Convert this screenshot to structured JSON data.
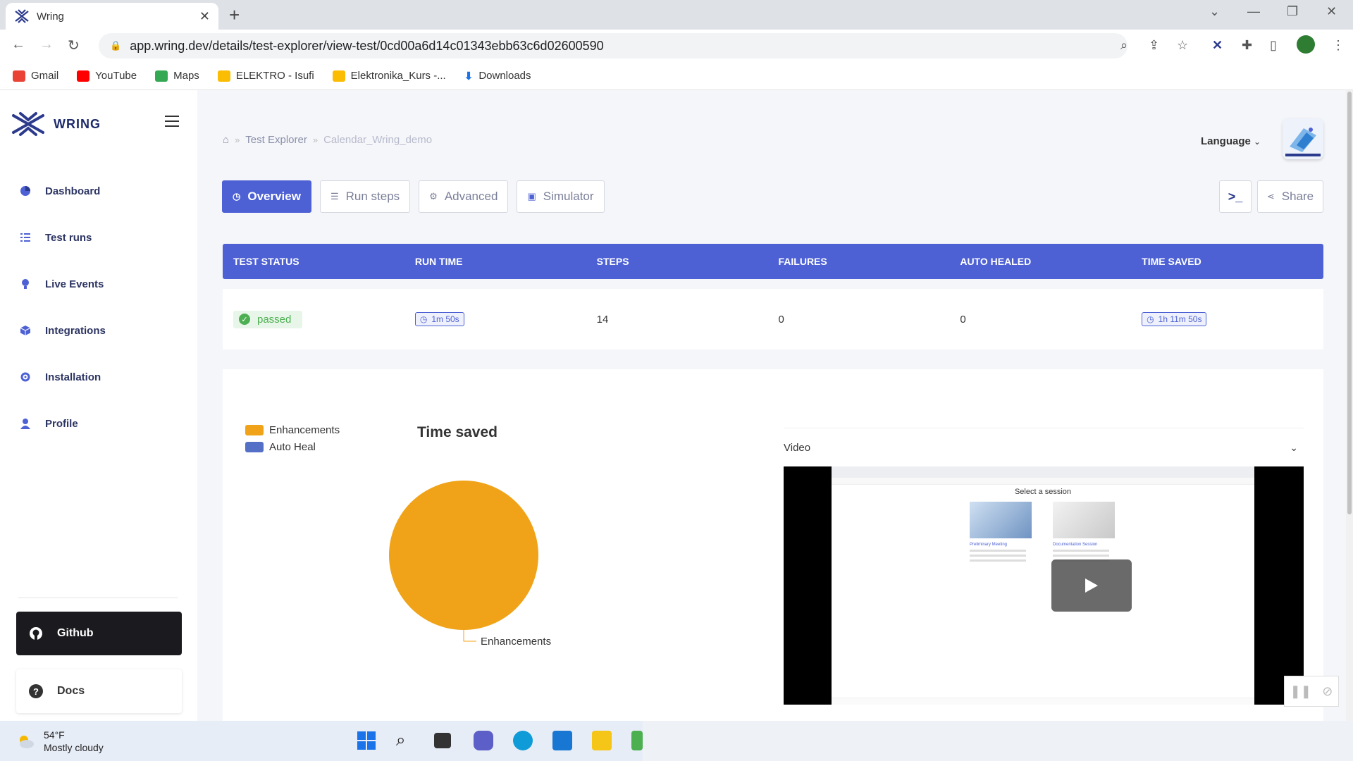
{
  "browser": {
    "tab_title": "Wring",
    "url": "app.wring.dev/details/test-explorer/view-test/0cd00a6d14c01343ebb63c6d02600590",
    "bookmarks": [
      {
        "label": "Gmail",
        "color": "#ea4335"
      },
      {
        "label": "YouTube",
        "color": "#ff0000"
      },
      {
        "label": "Maps",
        "color": "#34a853"
      },
      {
        "label": "ELEKTRO - Isufi",
        "color": "#fbbc04"
      },
      {
        "label": "Elektronika_Kurs -...",
        "color": "#fbbc04"
      },
      {
        "label": "Downloads",
        "color": "#1a73e8"
      }
    ]
  },
  "sidebar": {
    "logo_text": "WRING",
    "items": [
      {
        "label": "Dashboard",
        "icon": "pie-chart-icon"
      },
      {
        "label": "Test runs",
        "icon": "list-icon"
      },
      {
        "label": "Live Events",
        "icon": "bulb-icon"
      },
      {
        "label": "Integrations",
        "icon": "cube-icon"
      },
      {
        "label": "Installation",
        "icon": "gear-icon"
      },
      {
        "label": "Profile",
        "icon": "user-icon"
      }
    ],
    "github_label": "Github",
    "docs_label": "Docs"
  },
  "header": {
    "breadcrumb": [
      "Test Explorer",
      "Calendar_Wring_demo"
    ],
    "language_label": "Language"
  },
  "tabs": {
    "overview": "Overview",
    "run_steps": "Run steps",
    "advanced": "Advanced",
    "simulator": "Simulator",
    "share": "Share",
    "terminal": ">_"
  },
  "stats": {
    "headers": [
      "TEST STATUS",
      "RUN TIME",
      "STEPS",
      "FAILURES",
      "AUTO HEALED",
      "TIME SAVED"
    ],
    "status": "passed",
    "run_time": "1m 50s",
    "steps": "14",
    "failures": "0",
    "auto_healed": "0",
    "time_saved": "1h 11m 50s"
  },
  "chart_data": {
    "type": "pie",
    "title": "Time saved",
    "legend": [
      {
        "label": "Enhancements",
        "color": "#f0a318"
      },
      {
        "label": "Auto Heal",
        "color": "#5470c6"
      }
    ],
    "slices": [
      {
        "label": "Enhancements",
        "value": 100,
        "color": "#f0a318"
      },
      {
        "label": "Auto Heal",
        "value": 0,
        "color": "#5470c6"
      }
    ],
    "slice_label": "Enhancements"
  },
  "video": {
    "label": "Video",
    "frame_heading": "Select a session",
    "session_1": "Preliminary Meeting",
    "session_2": "Documentation Session"
  },
  "taskbar": {
    "temperature": "54°F",
    "condition": "Mostly cloudy"
  },
  "colors": {
    "accent": "#4d61d4",
    "passed": "#4caf50",
    "chart_orange": "#f0a318"
  }
}
